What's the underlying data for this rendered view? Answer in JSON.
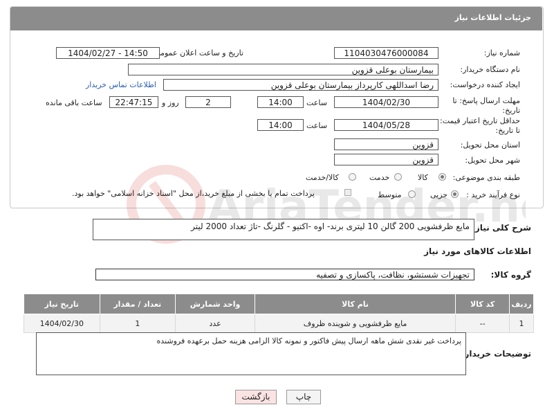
{
  "header": {
    "title": "جزئیات اطلاعات نیاز"
  },
  "form": {
    "need_number": {
      "label": "شماره نیاز:",
      "value": "1104030476000084"
    },
    "announce": {
      "label": "تاریخ و ساعت اعلان عمومی:",
      "value": "1404/02/27 - 14:50"
    },
    "buyer_org": {
      "label": "نام دستگاه خریدار:",
      "value": "بیمارستان بوعلی قزوین"
    },
    "creator": {
      "label": "ایجاد کننده درخواست:",
      "value": "رضا اسداللهی کارپرداز بیمارستان بوعلی قزوین",
      "contact_link": "اطلاعات تماس خریدار"
    },
    "reply_deadline": {
      "label1": "مهلت ارسال پاسخ: تا",
      "label2": "تاریخ:",
      "date": "1404/02/30",
      "time_label": "ساعت",
      "time": "14:00",
      "days": "2",
      "days_label": "روز و",
      "remaining": "22:47:15",
      "remaining_label": "ساعت باقی مانده"
    },
    "price_validity": {
      "label1": "حداقل تاریخ اعتبار قیمت:",
      "label2": "تا تاریخ:",
      "date": "1404/05/28",
      "time_label": "ساعت",
      "time": "14:00"
    },
    "delivery_province": {
      "label": "استان محل تحویل:",
      "value": "قزوین"
    },
    "delivery_city": {
      "label": "شهر محل تحویل:",
      "value": "قزوین"
    },
    "category": {
      "label": "طبقه بندی موضوعی:",
      "options": [
        "کالا",
        "خدمت",
        "کالا/خدمت"
      ],
      "selected": "کالا"
    },
    "purchase_process": {
      "label": "نوع فرآیند خرید :",
      "options": [
        "جزیی",
        "متوسط"
      ],
      "note": "پرداخت تمام یا بخشی از مبلغ خرید،از محل \"اسناد خزانه اسلامی\" خواهد بود."
    }
  },
  "description": {
    "label": "شرح کلی نیاز:",
    "value": "مایع ظرفشویی 200 گالن  10 لیتری  برند- اوه -اکتیو - گلرنگ -تاژ  تعداد 2000 لیتر"
  },
  "goods_section": {
    "title": "اطلاعات کالاهای مورد نیاز",
    "group_label": "گروه کالا:",
    "group_value": "تجهیزات شستشو، نظافت، پاکسازی و تصفیه"
  },
  "table": {
    "headers": [
      "ردیف",
      "کد کالا",
      "نام کالا",
      "واحد شمارش",
      "تعداد / مقدار",
      "تاریخ نیاز"
    ],
    "rows": [
      [
        "1",
        "--",
        "مایع ظرفشویی و شوینده ظروف",
        "عدد",
        "1",
        "1404/02/30"
      ]
    ]
  },
  "buyer_notes": {
    "label": "توضیحات خریدار:",
    "value": "پرداخت غیر نقدی شش ماهه ارسال پیش فاکتور و نمونه کالا الزامی هزینه حمل برعهده فروشنده"
  },
  "buttons": {
    "print": "چاپ",
    "back": "بازگشت"
  },
  "watermark": {
    "text": "AriaTender.net"
  }
}
